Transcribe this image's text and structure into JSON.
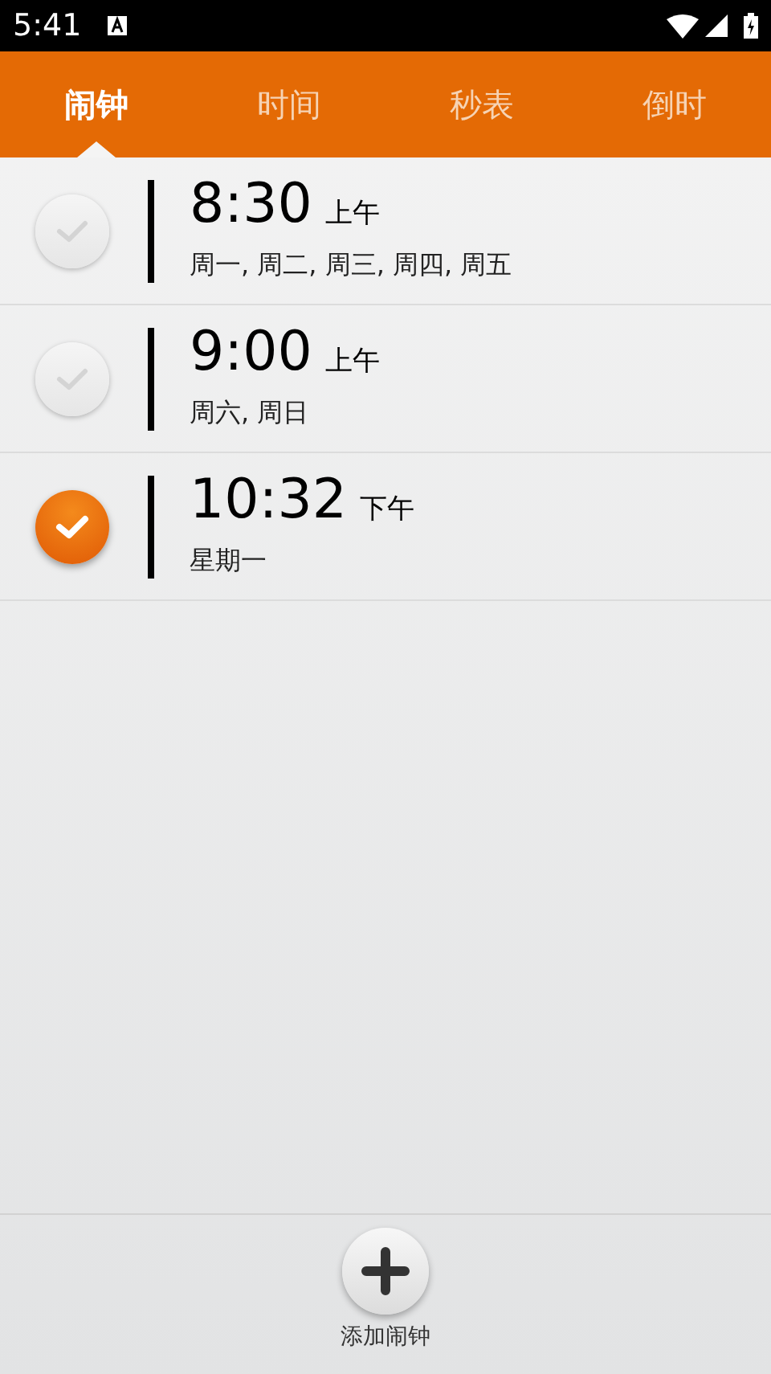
{
  "status_bar": {
    "time": "5:41"
  },
  "tabs": [
    {
      "label": "闹钟",
      "selected": true
    },
    {
      "label": "时间",
      "selected": false
    },
    {
      "label": "秒表",
      "selected": false
    },
    {
      "label": "倒时",
      "selected": false
    }
  ],
  "alarms": [
    {
      "time": "8:30",
      "period": "上午",
      "days": "周一, 周二, 周三, 周四, 周五",
      "on": false
    },
    {
      "time": "9:00",
      "period": "上午",
      "days": "周六, 周日",
      "on": false
    },
    {
      "time": "10:32",
      "period": "下午",
      "days": "星期一",
      "on": true
    }
  ],
  "add_button": {
    "label": "添加闹钟"
  }
}
